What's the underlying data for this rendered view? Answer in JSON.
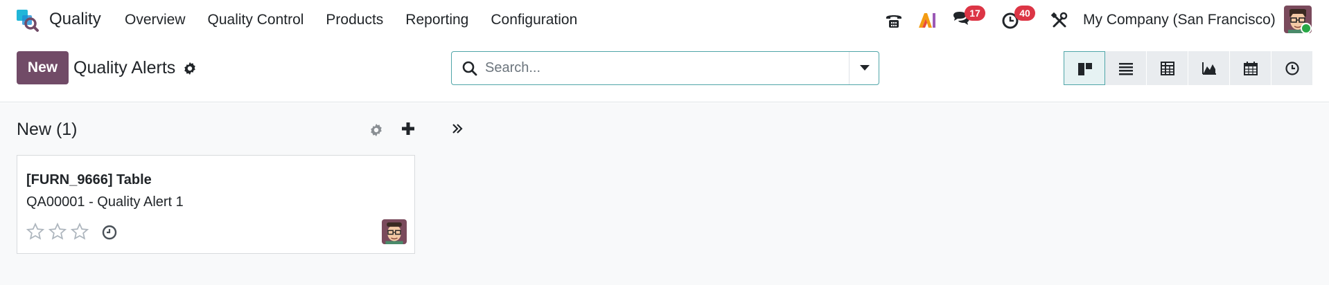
{
  "navbar": {
    "app_name": "Quality",
    "menu": [
      "Overview",
      "Quality Control",
      "Products",
      "Reporting",
      "Configuration"
    ],
    "systray": {
      "phone_icon": "phone-icon",
      "ai_icon": "ai-icon",
      "ai_label": "AI",
      "messages_count": "17",
      "activities_count": "40",
      "debug_icon": "tools-icon",
      "company": "My Company (San Francisco)"
    }
  },
  "control_panel": {
    "new_label": "New",
    "title": "Quality Alerts",
    "search_placeholder": "Search...",
    "views": [
      "kanban",
      "list",
      "pivot",
      "graph",
      "calendar",
      "activity"
    ],
    "active_view": "kanban"
  },
  "kanban": {
    "column_title": "New (1)",
    "cards": [
      {
        "title": "[FURN_9666] Table",
        "subtitle": "QA00001 - Quality Alert 1",
        "priority": 0,
        "priority_max": 3
      }
    ]
  },
  "colors": {
    "brand": "#714b67",
    "accent": "#4fa5a8",
    "badge": "#dc3545"
  }
}
